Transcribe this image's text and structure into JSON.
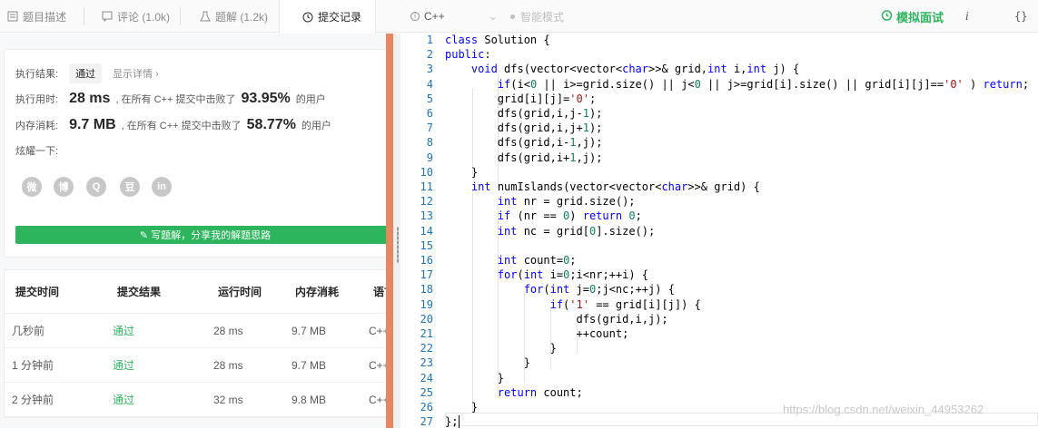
{
  "tabs": [
    {
      "label": "题目描述",
      "icon": "document-icon"
    },
    {
      "label": "评论 (1.0k)",
      "icon": "comment-icon"
    },
    {
      "label": "题解 (1.2k)",
      "icon": "flask-icon"
    },
    {
      "label": "提交记录",
      "icon": "clock-icon"
    }
  ],
  "language": "C++",
  "smart_mode": "智能模式",
  "mock_interview": "模拟面试",
  "result": {
    "status_label": "执行结果:",
    "status": "通过",
    "details_link": "显示详情 ›",
    "time_label": "执行用时:",
    "time_value": "28 ms",
    "time_mid": ", 在所有 C++ 提交中击败了",
    "time_pct": "93.95%",
    "time_suffix": "的用户",
    "mem_label": "内存消耗:",
    "mem_value": "9.7 MB",
    "mem_mid": ", 在所有 C++ 提交中击败了",
    "mem_pct": "58.77%",
    "mem_suffix": "的用户",
    "share_label": "炫耀一下:",
    "share_icons": [
      "wechat-icon",
      "weibo-icon",
      "qq-icon",
      "douban-icon",
      "linkedin-icon"
    ],
    "write_button": "✎ 写题解，分享我的解题思路"
  },
  "submissions": {
    "headers": [
      "提交时间",
      "提交结果",
      "运行时间",
      "内存消耗",
      "语言"
    ],
    "rows": [
      {
        "time": "几秒前",
        "result": "通过",
        "runtime": "28 ms",
        "memory": "9.7 MB",
        "lang": "C++"
      },
      {
        "time": "1 分钟前",
        "result": "通过",
        "runtime": "28 ms",
        "memory": "9.7 MB",
        "lang": "C++"
      },
      {
        "time": "2 分钟前",
        "result": "通过",
        "runtime": "32 ms",
        "memory": "9.8 MB",
        "lang": "C++"
      }
    ]
  },
  "code_lines": [
    "class Solution {",
    "public:",
    "    void dfs(vector<vector<char>>& grid,int i,int j) {",
    "        if(i<0 || i>=grid.size() || j<0 || j>=grid[i].size() || grid[i][j]=='0' ) return;",
    "        grid[i][j]='0';",
    "        dfs(grid,i,j-1);",
    "        dfs(grid,i,j+1);",
    "        dfs(grid,i-1,j);",
    "        dfs(grid,i+1,j);",
    "    }",
    "    int numIslands(vector<vector<char>>& grid) {",
    "        int nr = grid.size();",
    "        if (nr == 0) return 0;",
    "        int nc = grid[0].size();",
    "",
    "        int count=0;",
    "        for(int i=0;i<nr;++i) {",
    "            for(int j=0;j<nc;++j) {",
    "                if('1' == grid[i][j]) {",
    "                    dfs(grid,i,j);",
    "                    ++count;",
    "                }",
    "            }",
    "        }",
    "        return count;",
    "    }",
    "};"
  ],
  "watermark": "https://blog.csdn.net/weixin_44953262"
}
